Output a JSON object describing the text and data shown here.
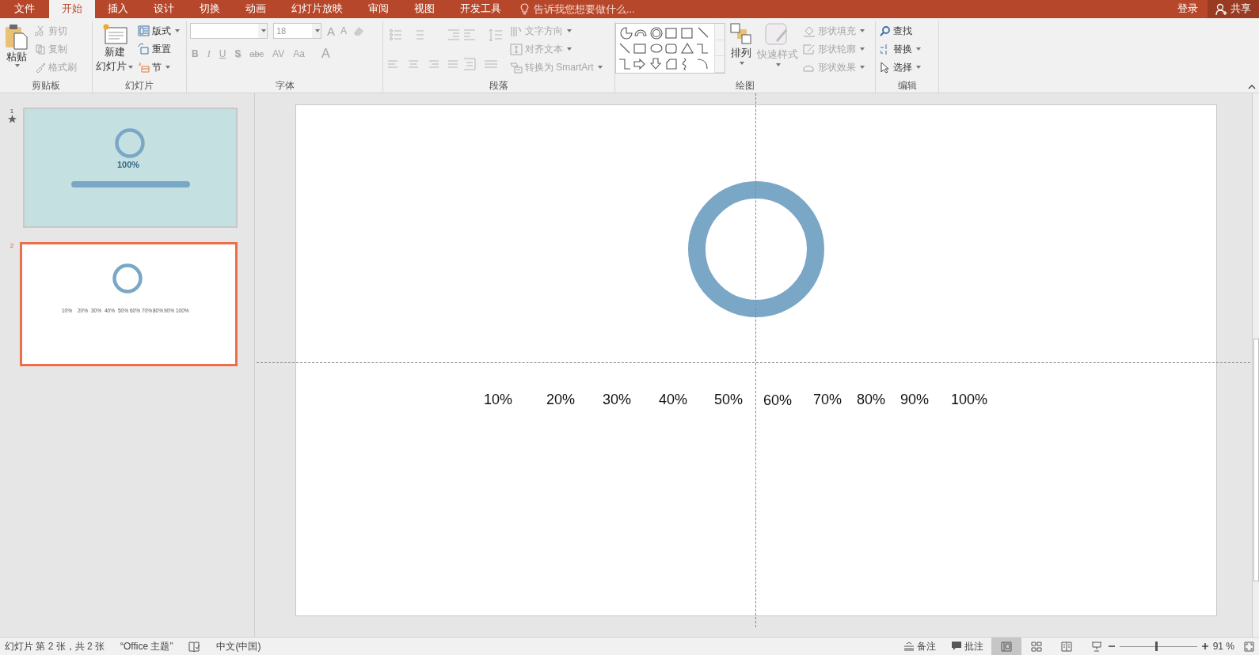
{
  "tabs": [
    {
      "label": "文件",
      "selected": false
    },
    {
      "label": "开始",
      "selected": true
    },
    {
      "label": "插入",
      "selected": false
    },
    {
      "label": "设计",
      "selected": false
    },
    {
      "label": "切换",
      "selected": false
    },
    {
      "label": "动画",
      "selected": false
    },
    {
      "label": "幻灯片放映",
      "selected": false
    },
    {
      "label": "审阅",
      "selected": false
    },
    {
      "label": "视图",
      "selected": false
    },
    {
      "label": "开发工具",
      "selected": false
    }
  ],
  "tell_me": {
    "placeholder": "告诉我您想要做什么..."
  },
  "account": {
    "sign_in": "登录",
    "share": "共享"
  },
  "ribbon": {
    "clipboard": {
      "label": "剪贴板",
      "paste": "粘贴",
      "items": [
        {
          "label": "剪切",
          "disabled": true
        },
        {
          "label": "复制",
          "disabled": true
        },
        {
          "label": "格式刷",
          "disabled": true
        }
      ]
    },
    "slides": {
      "label": "幻灯片",
      "new_slide": [
        "新建",
        "幻灯片"
      ],
      "items": [
        {
          "label": "版式",
          "disabled": false
        },
        {
          "label": "重置",
          "disabled": false
        },
        {
          "label": "节",
          "disabled": false
        }
      ]
    },
    "font": {
      "label": "字体",
      "font_size": "18",
      "size_buttons": [
        "A",
        "A"
      ],
      "format_buttons": [
        {
          "label": "B",
          "kind": "bold"
        },
        {
          "label": "I",
          "kind": "italic"
        },
        {
          "label": "U",
          "kind": "underline"
        },
        {
          "label": "S",
          "kind": "shadow"
        },
        {
          "label": "abc",
          "kind": "strike"
        },
        {
          "label": "AV",
          "kind": "spacing"
        },
        {
          "label": "Aa",
          "kind": "case"
        },
        {
          "label": "A",
          "kind": "color"
        }
      ],
      "disabled": true
    },
    "paragraph": {
      "label": "段落",
      "items": [
        {
          "label": "文字方向",
          "disabled": true
        },
        {
          "label": "对齐文本",
          "disabled": true
        },
        {
          "label": "转换为 SmartArt",
          "disabled": true
        }
      ]
    },
    "drawing": {
      "label": "绘图",
      "arrange": "排列",
      "quick_styles": {
        "label": "快速样式",
        "disabled": true
      },
      "items": [
        {
          "label": "形状填充",
          "disabled": true
        },
        {
          "label": "形状轮廓",
          "disabled": true
        },
        {
          "label": "形状效果",
          "disabled": true
        }
      ]
    },
    "editing": {
      "label": "编辑",
      "items": [
        {
          "label": "查找",
          "kind": "find"
        },
        {
          "label": "替换",
          "kind": "replace"
        },
        {
          "label": "选择",
          "kind": "select"
        }
      ]
    }
  },
  "thumbnails": [
    {
      "number": "1",
      "selected": false,
      "kind": "loading",
      "animated": true,
      "texts": [
        "100%"
      ]
    },
    {
      "number": "2",
      "selected": true,
      "kind": "labels",
      "animated": false,
      "texts": [
        "10%",
        "20%",
        "30%",
        "40%",
        "50%",
        "60%",
        "70%",
        "80%",
        "90%",
        "100%"
      ]
    }
  ],
  "slide": {
    "labels": [
      "10%",
      "20%",
      "30%",
      "40%",
      "50%",
      "60%",
      "70%",
      "80%",
      "90%",
      "100%"
    ]
  },
  "status_bar": {
    "slide_info": "幻灯片 第 2 张，共 2 张",
    "theme": "“Office 主题”",
    "language": "中文(中国)",
    "notes": "备注",
    "comments": "批注",
    "views": [
      {
        "kind": "normal",
        "selected": true
      },
      {
        "kind": "sorter",
        "selected": false
      },
      {
        "kind": "reading",
        "selected": false
      },
      {
        "kind": "show",
        "selected": false
      }
    ],
    "zoom": {
      "level": 0.46,
      "reading": "91 %"
    }
  }
}
